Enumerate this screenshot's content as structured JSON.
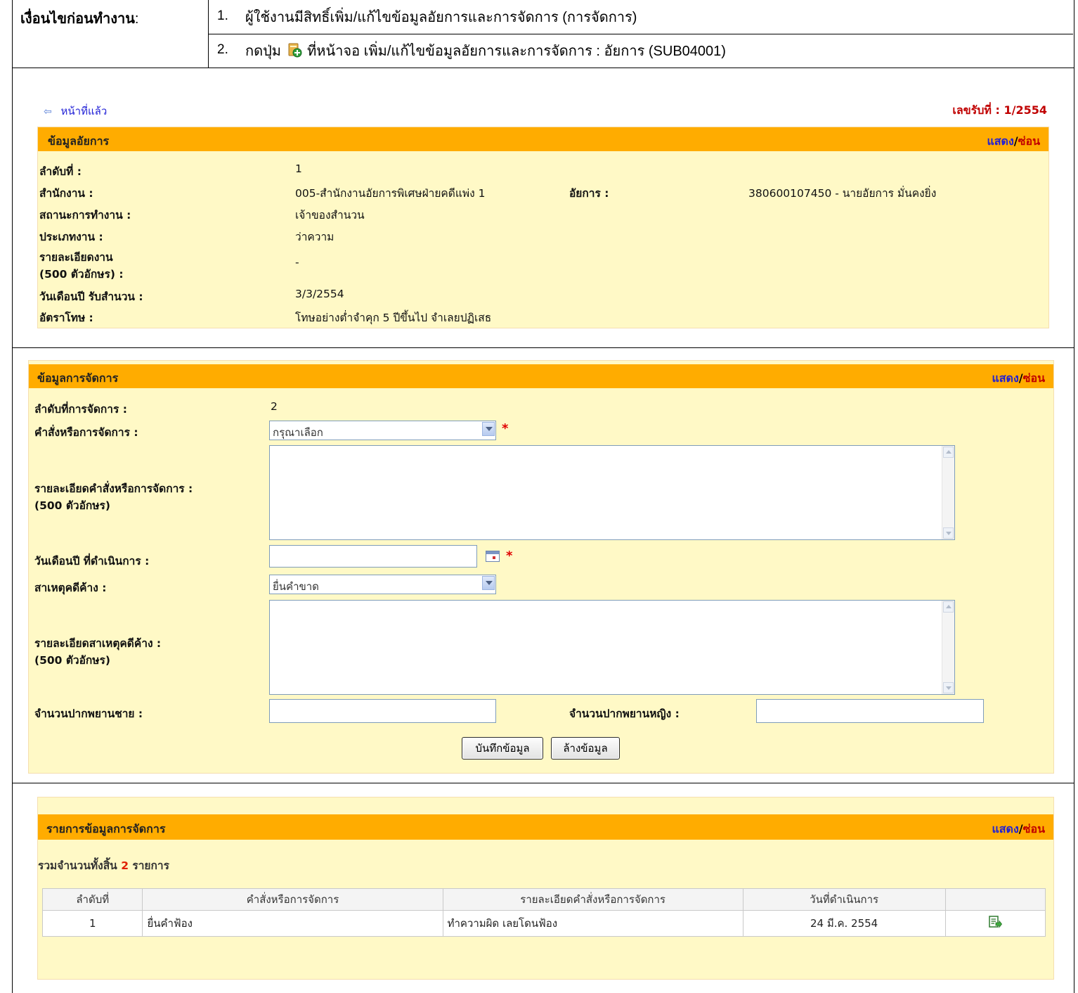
{
  "preconditions": {
    "label": "เงื่อนไขก่อนทำงาน",
    "label_colon": ":",
    "items": [
      {
        "num": "1.",
        "text": "ผู้ใช้งานมีสิทธิ์เพิ่ม/แก้ไขข้อมูลอัยการและการจัดการ (การจัดการ)"
      },
      {
        "num": "2.",
        "text_before": "กดปุ่ม",
        "icon": "add-management-icon",
        "text_after": "ที่หน้าจอ เพิ่ม/แก้ไขข้อมูลอัยการและการจัดการ : อัยการ (SUB04001)"
      }
    ]
  },
  "nav": {
    "back_label": "หน้าที่แล้ว",
    "receipt_label": "เลขรับที่ :",
    "receipt_value": "1/2554"
  },
  "toggle": {
    "show": "แสดง",
    "sep": "/",
    "hide": "ซ่อน"
  },
  "prosecutor_panel": {
    "title": "ข้อมูลอัยการ",
    "order_label": "ลำดับที่ :",
    "order_value": "1",
    "office_label": "สำนักงาน :",
    "office_value": "005-สำนักงานอัยการพิเศษฝ่ายคดีแพ่ง 1",
    "prosecutor_label": "อัยการ :",
    "prosecutor_value": "380600107450 - นายอัยการ มั่นคงยิ่ง",
    "status_label": "สถานะการทำงาน :",
    "status_value": "เจ้าของสำนวน",
    "worktype_label": "ประเภทงาน :",
    "worktype_value": "ว่าความ",
    "detail_label_1": "รายละเอียดงาน",
    "detail_label_2": "(500 ตัวอักษร) :",
    "detail_value": "-",
    "received_label": "วันเดือนปี รับสำนวน :",
    "received_value": "3/3/2554",
    "penalty_label": "อัตราโทษ :",
    "penalty_value": "โทษอย่างต่ำจำคุก 5 ปีขึ้นไป จำเลยปฏิเสธ"
  },
  "management_panel": {
    "title": "ข้อมูลการจัดการ",
    "order_label": "ลำดับที่การจัดการ :",
    "order_value": "2",
    "command_label": "คำสั่งหรือการจัดการ :",
    "command_selected": "กรุณาเลือก",
    "command_detail_label_1": "รายละเอียดคำสั่งหรือการจัดการ :",
    "command_detail_label_2": "(500 ตัวอักษร)",
    "date_label": "วันเดือนปี ที่ดำเนินการ :",
    "pending_reason_label": "สาเหตุคดีค้าง :",
    "pending_reason_selected": "ยื่นคำขาด",
    "pending_detail_label_1": "รายละเอียดสาเหตุคดีค้าง :",
    "pending_detail_label_2": "(500 ตัวอักษร)",
    "male_witness_label": "จำนวนปากพยานชาย :",
    "female_witness_label": "จำนวนปากพยานหญิง :",
    "required_mark": "*",
    "save_button": "บันทึกข้อมูล",
    "clear_button": "ล้างข้อมูล"
  },
  "list_panel": {
    "title": "รายการข้อมูลการจัดการ",
    "total_prefix": "รวมจำนวนทั้งสิ้น",
    "total_count": "2",
    "total_suffix": "รายการ",
    "columns": [
      "ลำดับที่",
      "คำสั่งหรือการจัดการ",
      "รายละเอียดคำสั่งหรือการจัดการ",
      "วันที่ดำเนินการ",
      ""
    ],
    "rows": [
      {
        "no": "1",
        "command": "ยื่นคำฟ้อง",
        "detail": "ทำความผิด เลยโดนฟ้อง",
        "date": "24 มี.ค. 2554",
        "action_icon": "edit-record-icon"
      }
    ]
  },
  "colors": {
    "panel_bg": "#fff9c6",
    "header_bg": "#ffac00",
    "link": "#1f1fd6",
    "red": "#c00000"
  }
}
